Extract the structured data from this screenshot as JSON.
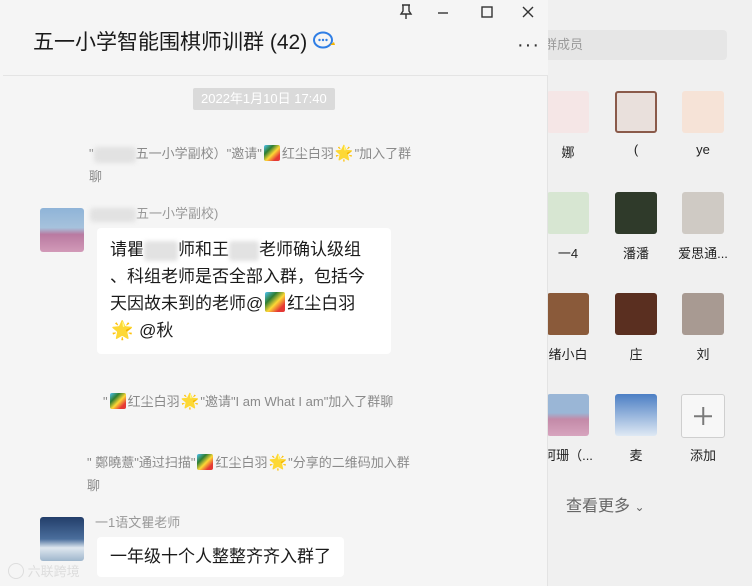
{
  "chat": {
    "title": "五一小学智能围棋师训群",
    "member_count": "(42)",
    "timestamp": "2022年1月10日 17:40",
    "sys1_a": "\"",
    "sys1_b": "五一小学副校）\"邀请\"",
    "sys1_c": "红尘白羽",
    "sys1_d": "\"加入了群",
    "sys1_e": "聊",
    "msg1_sender": "五一小学副校)",
    "msg1_line1a": "请瞿",
    "msg1_line1b": "师和王",
    "msg1_line1c": "老师确认级组",
    "msg1_line2": "、科组老师是否全部入群，包括今",
    "msg1_line3": "天因故未到的老师@",
    "msg1_line3b": "红尘白羽",
    "msg1_line4": "@秋",
    "sys2_a": "\"",
    "sys2_b": "红尘白羽",
    "sys2_c": "\"邀请\"I am What I am\"加入了群聊",
    "sys3_a": "\" 鄭曉薏\"通过扫描\"",
    "sys3_b": "红尘白羽",
    "sys3_c": "\"分享的二维码加入群",
    "sys3_d": "聊",
    "msg2_sender": "一1语文瞿老师",
    "msg2_text": "一年级十个人整整齐齐入群了"
  },
  "members": {
    "search_placeholder": "群成员",
    "items": [
      {
        "name": "娜"
      },
      {
        "name": "("
      },
      {
        "name": "ye"
      },
      {
        "name": "一4"
      },
      {
        "name": "潘潘"
      },
      {
        "name": "爱思通..."
      },
      {
        "name": "绪小白"
      },
      {
        "name": "庄"
      },
      {
        "name": "刘"
      },
      {
        "name": "珂珊（..."
      },
      {
        "name": "麦"
      }
    ],
    "add_label": "添加",
    "see_more": "查看更多"
  },
  "watermark": "六联跨境"
}
